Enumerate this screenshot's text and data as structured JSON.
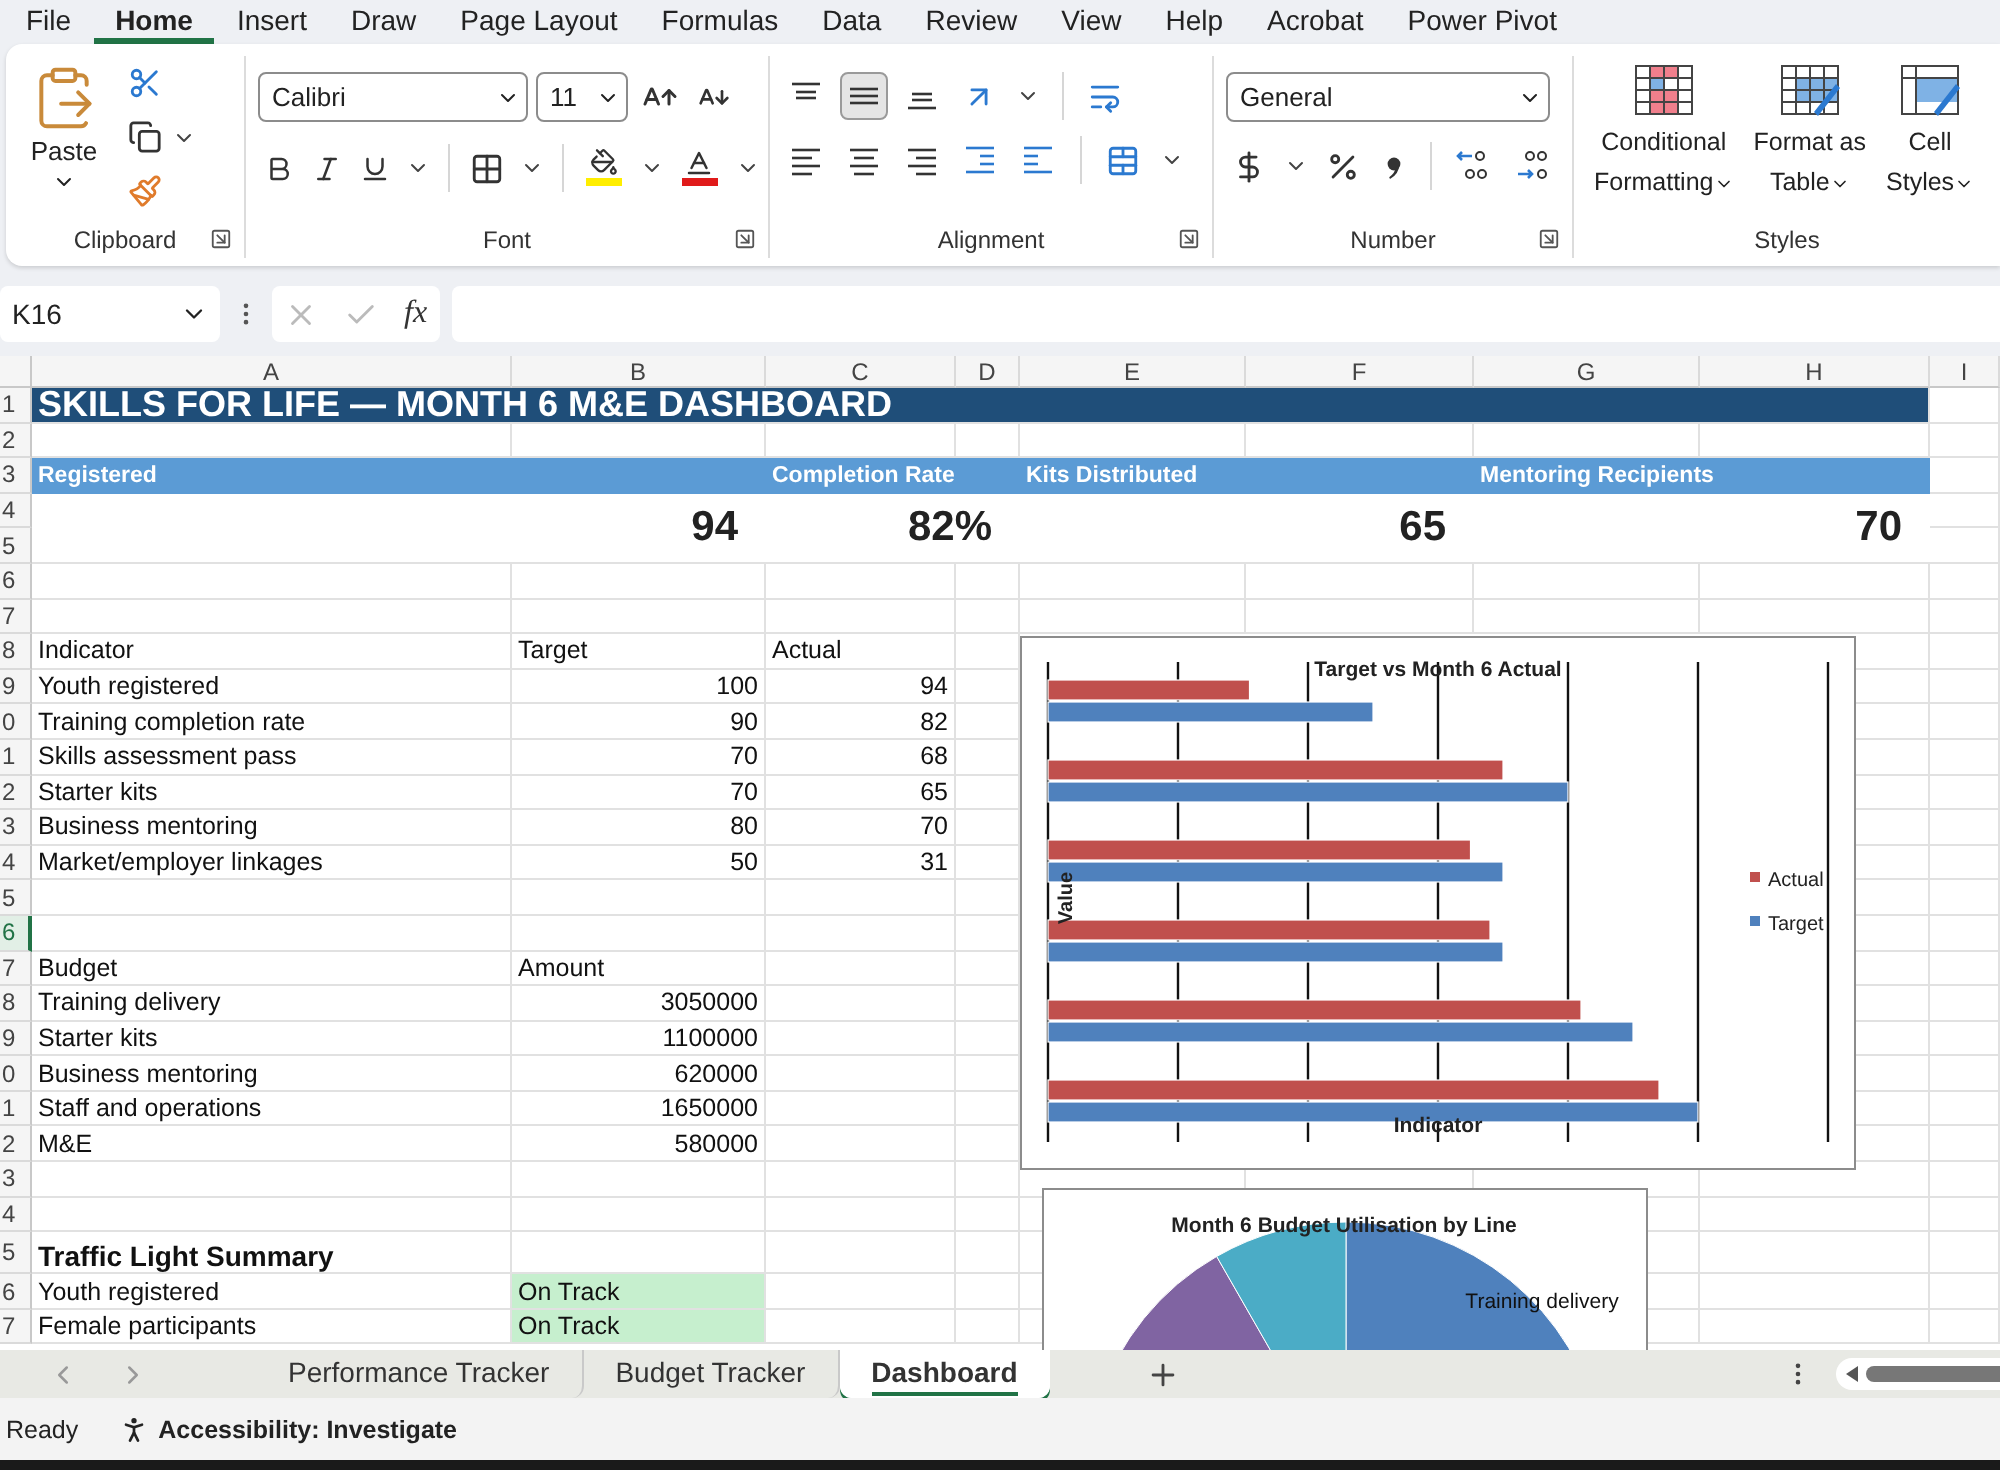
{
  "menu_tabs": [
    {
      "label": "File",
      "selected": false
    },
    {
      "label": "Home",
      "selected": true
    },
    {
      "label": "Insert",
      "selected": false
    },
    {
      "label": "Draw",
      "selected": false
    },
    {
      "label": "Page Layout",
      "selected": false
    },
    {
      "label": "Formulas",
      "selected": false
    },
    {
      "label": "Data",
      "selected": false
    },
    {
      "label": "Review",
      "selected": false
    },
    {
      "label": "View",
      "selected": false
    },
    {
      "label": "Help",
      "selected": false
    },
    {
      "label": "Acrobat",
      "selected": false
    },
    {
      "label": "Power Pivot",
      "selected": false
    }
  ],
  "ribbon": {
    "paste_label": "Paste",
    "font_name": "Calibri",
    "font_size": "11",
    "number_format": "General",
    "vertical_align": [
      {
        "kind": "top",
        "selected": false
      },
      {
        "kind": "middle",
        "selected": true
      },
      {
        "kind": "bottom",
        "selected": false
      }
    ],
    "styles_buttons": [
      {
        "kind": "conditional",
        "lines": [
          "Conditional",
          "Formatting"
        ]
      },
      {
        "kind": "table",
        "lines": [
          "Format as",
          "Table"
        ]
      },
      {
        "kind": "cell",
        "lines": [
          "Cell",
          "Styles"
        ]
      }
    ],
    "groups": [
      "Clipboard",
      "Font",
      "Alignment",
      "Number",
      "Styles"
    ]
  },
  "formula_bar": {
    "name_box": "K16",
    "function_label": "fx"
  },
  "columns": [
    "A",
    "B",
    "C",
    "D",
    "E",
    "F",
    "G",
    "H",
    "I"
  ],
  "row_headers": [
    {
      "label": "1",
      "selected": false
    },
    {
      "label": "2",
      "selected": false
    },
    {
      "label": "3",
      "selected": false
    },
    {
      "label": "4",
      "selected": false
    },
    {
      "label": "5",
      "selected": false
    },
    {
      "label": "6",
      "selected": false
    },
    {
      "label": "7",
      "selected": false
    },
    {
      "label": "8",
      "selected": false
    },
    {
      "label": "9",
      "selected": false
    },
    {
      "label": "0",
      "selected": false
    },
    {
      "label": "1",
      "selected": false
    },
    {
      "label": "2",
      "selected": false
    },
    {
      "label": "3",
      "selected": false
    },
    {
      "label": "4",
      "selected": false
    },
    {
      "label": "5",
      "selected": false
    },
    {
      "label": "6",
      "selected": true
    },
    {
      "label": "7",
      "selected": false
    },
    {
      "label": "8",
      "selected": false
    },
    {
      "label": "9",
      "selected": false
    },
    {
      "label": "0",
      "selected": false
    },
    {
      "label": "1",
      "selected": false
    },
    {
      "label": "2",
      "selected": false
    },
    {
      "label": "3",
      "selected": false
    },
    {
      "label": "4",
      "selected": false
    },
    {
      "label": "5",
      "selected": false
    },
    {
      "label": "6",
      "selected": false
    },
    {
      "label": "7",
      "selected": false
    }
  ],
  "title": "SKILLS FOR LIFE — MONTH 6 M&E DASHBOARD",
  "kpis": [
    {
      "label": "Registered",
      "value": "94"
    },
    {
      "label": "Completion Rate",
      "value": "82%"
    },
    {
      "label": "Kits Distributed",
      "value": "65"
    },
    {
      "label": "Mentoring Recipients",
      "value": "70"
    }
  ],
  "indicator_table": {
    "headers": [
      "Indicator",
      "Target",
      "Actual"
    ],
    "rows": [
      {
        "name": "Youth registered",
        "target": "100",
        "actual": "94"
      },
      {
        "name": "Training completion rate",
        "target": "90",
        "actual": "82"
      },
      {
        "name": "Skills assessment pass",
        "target": "70",
        "actual": "68"
      },
      {
        "name": "Starter kits",
        "target": "70",
        "actual": "65"
      },
      {
        "name": "Business mentoring",
        "target": "80",
        "actual": "70"
      },
      {
        "name": "Market/employer linkages",
        "target": "50",
        "actual": "31"
      }
    ]
  },
  "budget_table": {
    "headers": [
      "Budget",
      "Amount"
    ],
    "rows": [
      {
        "name": "Training delivery",
        "amount": "3050000"
      },
      {
        "name": "Starter kits",
        "amount": "1100000"
      },
      {
        "name": "Business mentoring",
        "amount": "620000"
      },
      {
        "name": "Staff and operations",
        "amount": "1650000"
      },
      {
        "name": "M&E",
        "amount": "580000"
      }
    ]
  },
  "traffic_light": {
    "title": "Traffic Light Summary",
    "rows": [
      {
        "name": "Youth registered",
        "status": "On Track",
        "color": "#c6efce"
      },
      {
        "name": "Female participants",
        "status": "On Track",
        "color": "#c6efce"
      }
    ]
  },
  "bar_chart": {
    "title": "Target vs Month 6 Actual",
    "xlabel": "Indicator",
    "ylabel": "Value",
    "legend": [
      {
        "kind": "actual",
        "label": "Actual",
        "color": "#c0504d"
      },
      {
        "kind": "target",
        "label": "Target",
        "color": "#4f81bd"
      }
    ]
  },
  "pie_chart": {
    "title": "Month 6 Budget Utilisation by Line",
    "slice_label": "Training delivery"
  },
  "sheet_tabs": [
    {
      "label": "Performance Tracker",
      "selected": false
    },
    {
      "label": "Budget Tracker",
      "selected": false
    },
    {
      "label": "Dashboard",
      "selected": true
    }
  ],
  "status_bar": {
    "mode": "Ready",
    "accessibility": "Accessibility: Investigate"
  }
}
